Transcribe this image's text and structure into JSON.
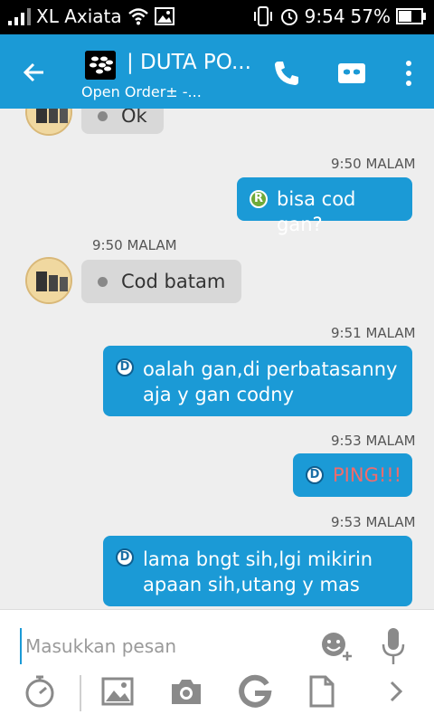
{
  "status_bar": {
    "carrier": "XL Axiata",
    "time": "9:54",
    "battery": "57%"
  },
  "header": {
    "title": "| DUTA PO...",
    "subtitle": "Open Order± -..."
  },
  "messages": [
    {
      "direction": "in",
      "text": "Ok"
    },
    {
      "direction": "out",
      "time": "9:50 MALAM",
      "badge": "R",
      "text": "bisa cod gan?"
    },
    {
      "direction": "in",
      "time": "9:50 MALAM",
      "text": "Cod batam"
    },
    {
      "direction": "out",
      "time": "9:51 MALAM",
      "badge": "D",
      "text_line1": "oalah gan,di perbatasanny",
      "text_line2": "aja y gan codny"
    },
    {
      "direction": "out",
      "time": "9:53 MALAM",
      "badge": "D",
      "text": "PING!!!",
      "color": "#f26b6b"
    },
    {
      "direction": "out",
      "time": "9:53 MALAM",
      "badge": "D",
      "text_line1": "lama bngt sih,lgi mikirin",
      "text_line2": "apaan sih,utang y mas"
    }
  ],
  "composer": {
    "placeholder": "Masukkan pesan"
  },
  "toolbar_icons": [
    "timer-icon",
    "image-icon",
    "camera-icon",
    "google-icon",
    "document-icon",
    "chevron-right-icon"
  ],
  "colors": {
    "accent": "#1b9ad6",
    "incoming_bubble": "#d8d8d8",
    "ping": "#f26b6b",
    "background": "#eeeeee"
  }
}
